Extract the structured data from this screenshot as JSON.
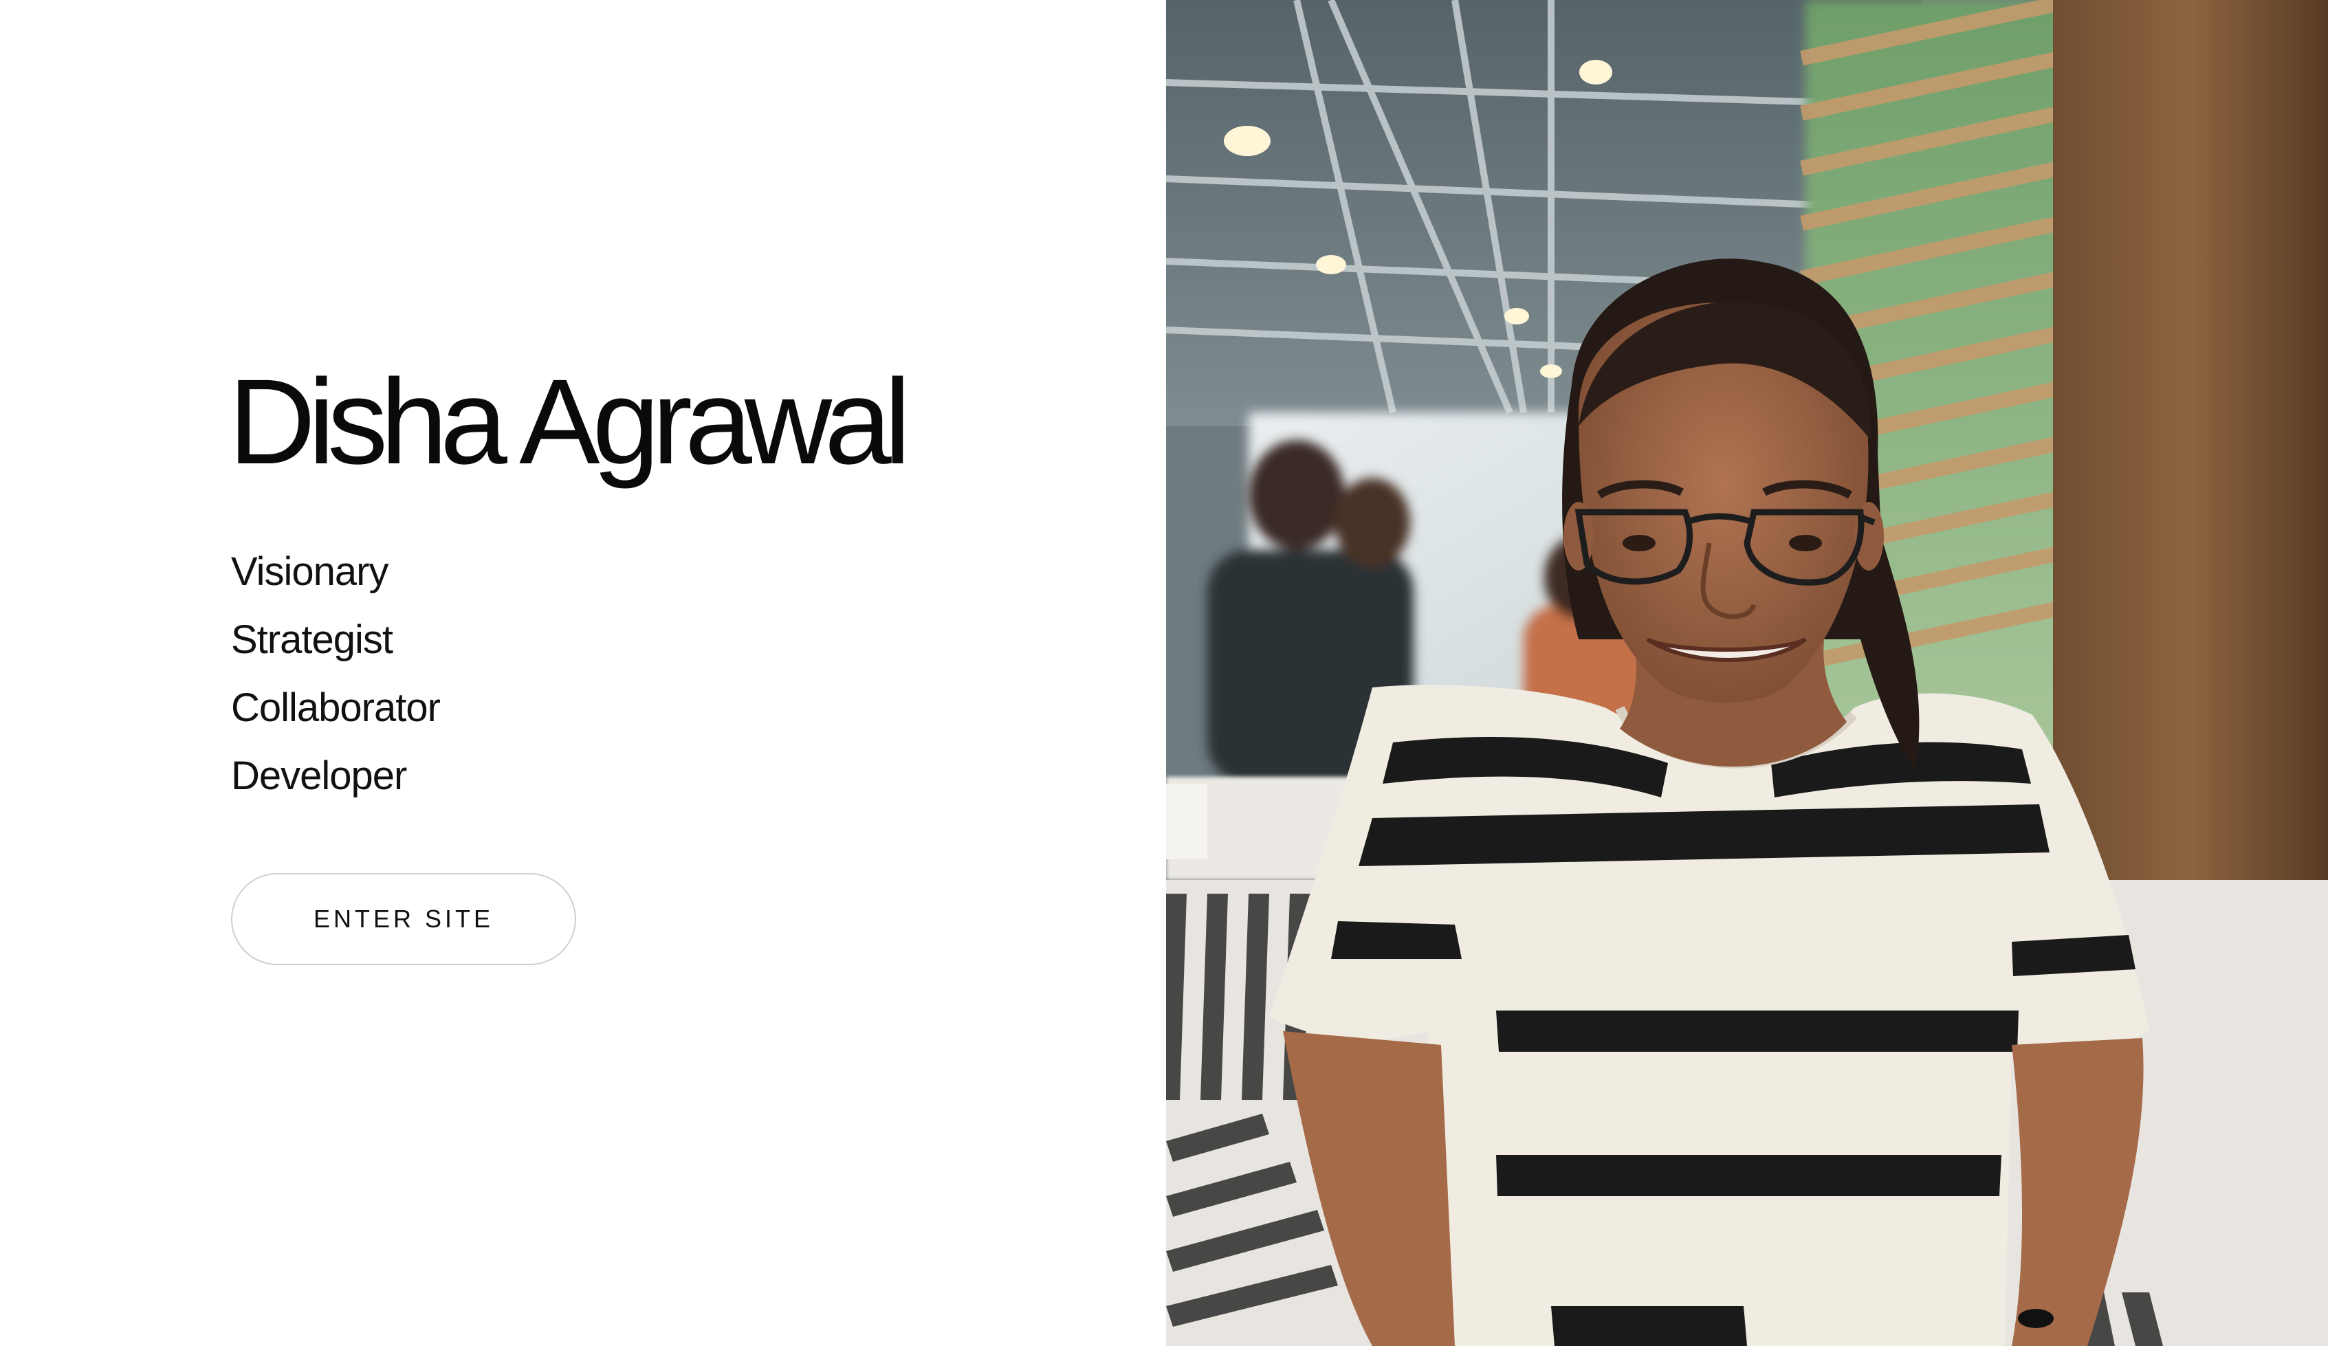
{
  "profile": {
    "name": "Disha Agrawal",
    "roles": [
      "Visionary",
      "Strategist",
      "Collaborator",
      "Developer"
    ]
  },
  "actions": {
    "enter_label": "ENTER SITE"
  },
  "photo": {
    "subject": "portrait-photo"
  },
  "colors": {
    "background": "#ffffff",
    "text": "#0a0a0a",
    "button_border": "#cfcfcf"
  }
}
